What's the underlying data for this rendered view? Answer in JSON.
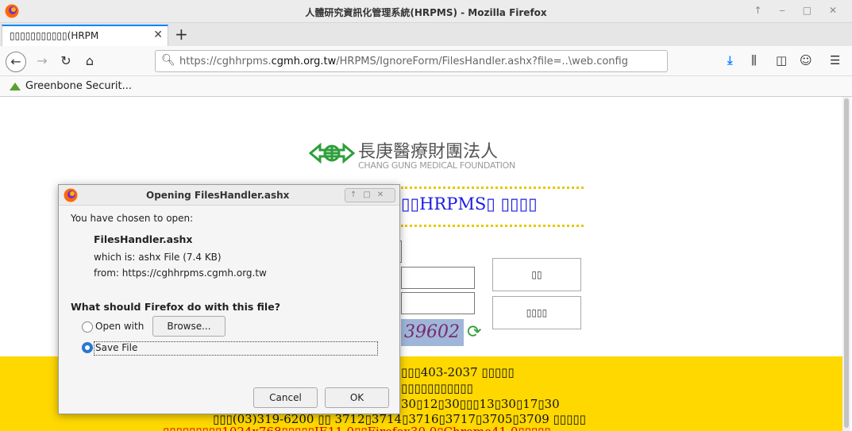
{
  "window": {
    "title": "人體研究資訊化管理系統(HRPMS) - Mozilla Firefox",
    "controls": "↑ ‒ □ ✕"
  },
  "tabs": {
    "active_label": "▯▯▯▯▯▯▯▯▯▯▯(HRPM",
    "close": "✕",
    "new_tab": "+"
  },
  "navbar": {
    "url_host_pre": "https://cghhrpms.",
    "url_host_bold": "cgmh.org.tw",
    "url_path": "/HRPMS/IgnoreForm/FilesHandler.ashx?file=..\\web.config"
  },
  "bookmarks": [
    {
      "label": "Greenbone Securit..."
    }
  ],
  "page": {
    "org_name": "長庚醫療財團法人",
    "org_name_en": "CHANG GUNG MEDICAL FOUNDATION",
    "system_title": "▯▯HRPMS▯ ▯▯▯▯",
    "button_login": "▯▯",
    "button_reset": "▯▯▯▯",
    "captcha_text": "39602",
    "info_lines": [
      "▯▯▯403-2037 ▯▯▯▯▯",
      "▯▯▯▯▯▯▯▯▯▯▯",
      "30▯12▯30▯▯▯13▯30▯17▯30",
      "▯▯▯(03)319-6200 ▯▯ 3712▯3714▯3716▯3717▯3705▯3709 ▯▯▯▯▯",
      "▯▯▯▯▯▯▯▯▯1024x768▯▯▯▯▯IE11.0▯▯Firefox30.0▯Chrome41.0▯▯▯▯▯"
    ]
  },
  "dialog": {
    "title": "Opening FilesHandler.ashx",
    "chosen_label": "You have chosen to open:",
    "file_name": "FilesHandler.ashx",
    "which_is": "which is:  ashx File (7.4 KB)",
    "from": "from:  https://cghhrpms.cgmh.org.tw",
    "question": "What should Firefox do with this file?",
    "open_with_label": "Open with",
    "browse_label": "Browse...",
    "save_file_label": "Save File",
    "cancel_label": "Cancel",
    "ok_label": "OK",
    "selected_option": "save_file"
  },
  "colors": {
    "accent": "#0a84ff",
    "band_yellow": "#ffd800",
    "title_blue": "#1a1ae6",
    "logo_green": "#2e9e3a"
  }
}
